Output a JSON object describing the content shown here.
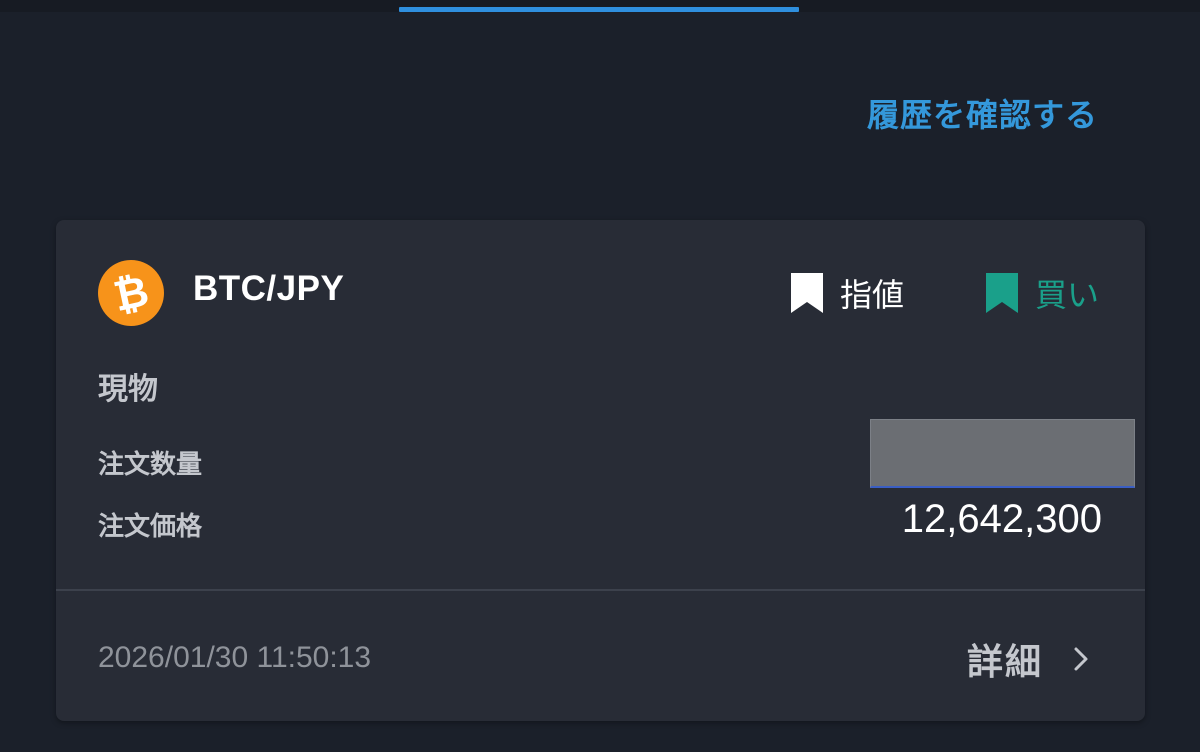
{
  "header": {
    "history_link": "履歴を確認する"
  },
  "order": {
    "coin_icon": "bitcoin-icon",
    "pair": "BTC/JPY",
    "order_type": "指値",
    "side": "買い",
    "market": "現物",
    "quantity_label": "注文数量",
    "price_label": "注文価格",
    "price_value": "12,642,300",
    "timestamp": "2026/01/30 11:50:13",
    "details_label": "詳細"
  },
  "colors": {
    "accent": "#3498db",
    "buy": "#1aa08a",
    "bitcoin": "#f7931a",
    "background": "#1b202a",
    "card": "#282c36"
  }
}
